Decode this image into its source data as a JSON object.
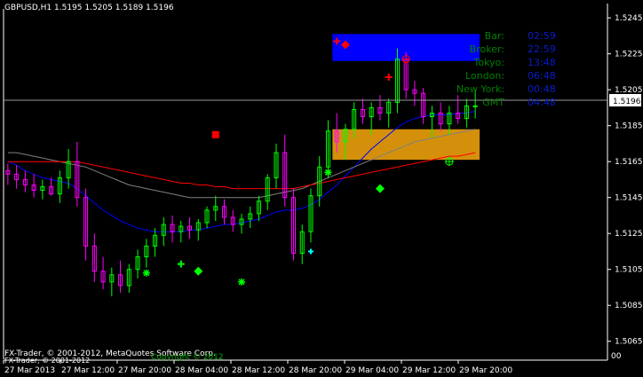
{
  "symbol_info": "GBPUSD,H1  1.5195 1.5205 1.5189 1.5196",
  "copyright": "FX-Trader, © 2001-2012, MetaQuotes Software Corp.",
  "copyright_under": "FX-Trader, © 2001-2012",
  "ghost_text": "Copyright © 2012",
  "current_price": "1.5196",
  "corner_marker": "00",
  "clocks": [
    {
      "label": "Bar:",
      "value": "02:59"
    },
    {
      "label": "Broker:",
      "value": "22:59"
    },
    {
      "label": "Tokyo:",
      "value": "13:48"
    },
    {
      "label": "London:",
      "value": "06:48"
    },
    {
      "label": "New York:",
      "value": "00:48"
    },
    {
      "label": "GMT",
      "value": "04:48"
    }
  ],
  "colors": {
    "background": "#000000",
    "axis": "#ffffff",
    "bull_candle": "#00ff00",
    "bear_candle": "#ff00ff",
    "ma_fast": "#0000ff",
    "ma_mid": "#808080",
    "ma_slow": "#ff0000",
    "box_blue": "#0000ff",
    "box_orange": "#d4900a",
    "clock_label": "#008000",
    "clock_value": "#0a1cc8"
  },
  "chart_data": {
    "type": "candlestick",
    "symbol": "GBPUSD",
    "timeframe": "H1",
    "y_ticks": [
      "1.5245",
      "1.5225",
      "1.5205",
      "1.5185",
      "1.5165",
      "1.5145",
      "1.5125",
      "1.5105",
      "1.5085",
      "1.5065"
    ],
    "x_ticks": [
      "27 Mar 2013",
      "27 Mar 12:00",
      "27 Mar 20:00",
      "28 Mar 04:00",
      "28 Mar 12:00",
      "28 Mar 20:00",
      "29 Mar 04:00",
      "29 Mar 12:00",
      "29 Mar 20:00"
    ],
    "ylim": [
      1.5055,
      1.525
    ],
    "candles": [
      [
        1.516,
        1.5164,
        1.5152,
        1.5158
      ],
      [
        1.5158,
        1.5163,
        1.515,
        1.5155
      ],
      [
        1.5155,
        1.516,
        1.5148,
        1.5152
      ],
      [
        1.5152,
        1.5158,
        1.5145,
        1.5149
      ],
      [
        1.5149,
        1.5155,
        1.5144,
        1.5151
      ],
      [
        1.5151,
        1.5156,
        1.5146,
        1.5147
      ],
      [
        1.5147,
        1.516,
        1.5142,
        1.5156
      ],
      [
        1.5156,
        1.5172,
        1.515,
        1.5165
      ],
      [
        1.5165,
        1.5176,
        1.514,
        1.5145
      ],
      [
        1.5145,
        1.515,
        1.511,
        1.5118
      ],
      [
        1.5118,
        1.5125,
        1.5098,
        1.5104
      ],
      [
        1.5104,
        1.5112,
        1.5094,
        1.5098
      ],
      [
        1.5098,
        1.5106,
        1.509,
        1.5102
      ],
      [
        1.5102,
        1.511,
        1.5092,
        1.5096
      ],
      [
        1.5096,
        1.5108,
        1.5092,
        1.5105
      ],
      [
        1.5105,
        1.5116,
        1.51,
        1.5112
      ],
      [
        1.5112,
        1.5122,
        1.5106,
        1.5118
      ],
      [
        1.5118,
        1.5128,
        1.5112,
        1.5124
      ],
      [
        1.5124,
        1.5134,
        1.5118,
        1.513
      ],
      [
        1.513,
        1.5135,
        1.512,
        1.5126
      ],
      [
        1.5126,
        1.5132,
        1.512,
        1.5129
      ],
      [
        1.5129,
        1.5134,
        1.5122,
        1.5127
      ],
      [
        1.5127,
        1.5133,
        1.5121,
        1.5131
      ],
      [
        1.5131,
        1.514,
        1.5128,
        1.5138
      ],
      [
        1.5138,
        1.5146,
        1.5132,
        1.514
      ],
      [
        1.514,
        1.5144,
        1.513,
        1.5134
      ],
      [
        1.5134,
        1.5138,
        1.5126,
        1.513
      ],
      [
        1.513,
        1.5136,
        1.5125,
        1.5133
      ],
      [
        1.5133,
        1.514,
        1.5128,
        1.5136
      ],
      [
        1.5136,
        1.5146,
        1.5132,
        1.5143
      ],
      [
        1.5143,
        1.5158,
        1.5138,
        1.5156
      ],
      [
        1.5156,
        1.5175,
        1.515,
        1.517
      ],
      [
        1.517,
        1.518,
        1.514,
        1.5145
      ],
      [
        1.5145,
        1.515,
        1.511,
        1.5114
      ],
      [
        1.5114,
        1.513,
        1.5108,
        1.5126
      ],
      [
        1.5126,
        1.515,
        1.512,
        1.5146
      ],
      [
        1.5146,
        1.5168,
        1.514,
        1.5162
      ],
      [
        1.5162,
        1.5188,
        1.5156,
        1.5182
      ],
      [
        1.5182,
        1.5192,
        1.517,
        1.5176
      ],
      [
        1.5176,
        1.5186,
        1.5166,
        1.5183
      ],
      [
        1.5183,
        1.5198,
        1.5178,
        1.5194
      ],
      [
        1.5194,
        1.52,
        1.5186,
        1.519
      ],
      [
        1.519,
        1.5198,
        1.518,
        1.5195
      ],
      [
        1.5195,
        1.5202,
        1.5188,
        1.5192
      ],
      [
        1.5192,
        1.52,
        1.5184,
        1.5198
      ],
      [
        1.5198,
        1.5228,
        1.5192,
        1.5222
      ],
      [
        1.5222,
        1.5226,
        1.52,
        1.5205
      ],
      [
        1.5205,
        1.521,
        1.5196,
        1.5203
      ],
      [
        1.5203,
        1.5206,
        1.5186,
        1.519
      ],
      [
        1.519,
        1.5196,
        1.5178,
        1.5192
      ],
      [
        1.5192,
        1.5198,
        1.5182,
        1.5186
      ],
      [
        1.5186,
        1.5196,
        1.518,
        1.5192
      ],
      [
        1.5192,
        1.5202,
        1.5186,
        1.5189
      ],
      [
        1.5189,
        1.52,
        1.5184,
        1.5196
      ],
      [
        1.5196,
        1.5205,
        1.5189,
        1.5196
      ]
    ],
    "markers": [
      {
        "shape": "square",
        "color": "#ff0000",
        "i": 24,
        "y": 1.518
      },
      {
        "shape": "star",
        "color": "#00ff00",
        "i": 16,
        "y": 1.5103
      },
      {
        "shape": "cross",
        "color": "#00ff00",
        "i": 20,
        "y": 1.5108
      },
      {
        "shape": "diamond",
        "color": "#00ff00",
        "i": 22,
        "y": 1.5104
      },
      {
        "shape": "star",
        "color": "#00ff00",
        "i": 27,
        "y": 1.5098
      },
      {
        "shape": "cross-small",
        "color": "#00ffff",
        "i": 35,
        "y": 1.5115
      },
      {
        "shape": "star",
        "color": "#00ff00",
        "i": 37,
        "y": 1.5159
      },
      {
        "shape": "cross",
        "color": "#ff0000",
        "i": 38,
        "y": 1.5232
      },
      {
        "shape": "diamond",
        "color": "#ff0000",
        "i": 39,
        "y": 1.523
      },
      {
        "shape": "diamond",
        "color": "#00ff00",
        "i": 43,
        "y": 1.515
      },
      {
        "shape": "cross",
        "color": "#ff0000",
        "i": 44,
        "y": 1.5212
      },
      {
        "shape": "circle-cross",
        "color": "#ff0000",
        "i": 46,
        "y": 1.5222
      },
      {
        "shape": "circle-cross",
        "color": "#00ff00",
        "i": 51,
        "y": 1.5165
      }
    ],
    "zones": [
      {
        "color": "#0000ff",
        "i_from": 38,
        "i_to": 54,
        "y_top": 1.5236,
        "y_bottom": 1.5221
      },
      {
        "color": "#d4900a",
        "i_from": 38,
        "i_to": 54,
        "y_top": 1.5183,
        "y_bottom": 1.5166
      }
    ],
    "ma": {
      "fast": [
        1.5165,
        1.5163,
        1.516,
        1.5158,
        1.5156,
        1.5155,
        1.5154,
        1.5153,
        1.515,
        1.5146,
        1.5142,
        1.5138,
        1.5135,
        1.5132,
        1.513,
        1.5128,
        1.5127,
        1.5126,
        1.5126,
        1.5126,
        1.5126,
        1.5127,
        1.5127,
        1.5128,
        1.5129,
        1.513,
        1.513,
        1.5131,
        1.5132,
        1.5133,
        1.5135,
        1.5137,
        1.5138,
        1.5138,
        1.5139,
        1.5141,
        1.5144,
        1.5148,
        1.5152,
        1.5157,
        1.5162,
        1.5167,
        1.5172,
        1.5176,
        1.518,
        1.5184,
        1.5187,
        1.5189,
        1.519,
        1.5191,
        1.5191,
        1.5191,
        1.5192,
        1.5192,
        1.5193
      ],
      "mid": [
        1.517,
        1.517,
        1.5169,
        1.5168,
        1.5167,
        1.5166,
        1.5165,
        1.5164,
        1.5163,
        1.5162,
        1.516,
        1.5158,
        1.5156,
        1.5154,
        1.5152,
        1.5151,
        1.515,
        1.5149,
        1.5148,
        1.5147,
        1.5146,
        1.5145,
        1.5145,
        1.5145,
        1.5145,
        1.5145,
        1.5145,
        1.5145,
        1.5145,
        1.5145,
        1.5146,
        1.5147,
        1.5148,
        1.5149,
        1.515,
        1.5152,
        1.5154,
        1.5156,
        1.5158,
        1.516,
        1.5162,
        1.5164,
        1.5166,
        1.5168,
        1.517,
        1.5172,
        1.5174,
        1.5176,
        1.5177,
        1.5178,
        1.5179,
        1.518,
        1.5181,
        1.5182,
        1.5183
      ],
      "slow": [
        1.5165,
        1.5165,
        1.5165,
        1.5165,
        1.5165,
        1.5165,
        1.5165,
        1.5165,
        1.5165,
        1.5164,
        1.5163,
        1.5162,
        1.5161,
        1.516,
        1.5159,
        1.5158,
        1.5157,
        1.5156,
        1.5155,
        1.5154,
        1.5153,
        1.5153,
        1.5152,
        1.5152,
        1.5151,
        1.5151,
        1.515,
        1.515,
        1.515,
        1.515,
        1.515,
        1.515,
        1.515,
        1.515,
        1.5151,
        1.5152,
        1.5153,
        1.5154,
        1.5155,
        1.5156,
        1.5157,
        1.5158,
        1.5159,
        1.516,
        1.5161,
        1.5162,
        1.5163,
        1.5164,
        1.5165,
        1.5166,
        1.5167,
        1.5168,
        1.5168,
        1.5169,
        1.517
      ]
    }
  }
}
